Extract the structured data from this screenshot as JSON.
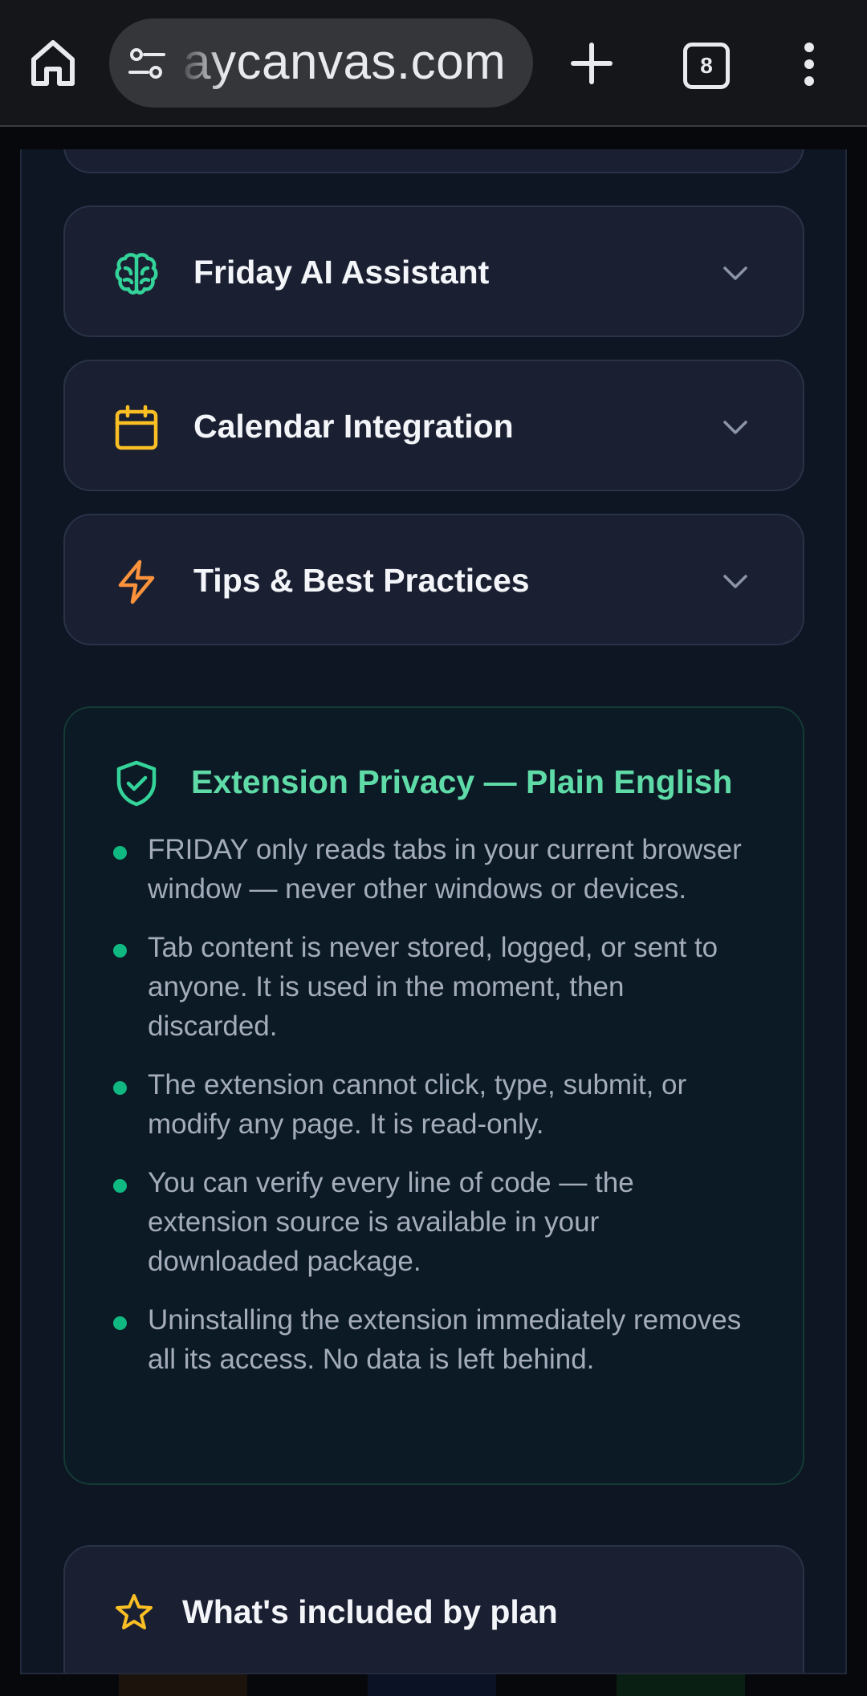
{
  "browser": {
    "url_text": "aycanvas.com",
    "tab_count": "8"
  },
  "accordion": [
    {
      "label": "Friday AI Assistant",
      "icon": "brain-icon",
      "color": "#34d399"
    },
    {
      "label": "Calendar Integration",
      "icon": "calendar-icon",
      "color": "#fbbf24"
    },
    {
      "label": "Tips & Best Practices",
      "icon": "lightning-icon",
      "color": "#fb923c"
    }
  ],
  "privacy": {
    "title": "Extension Privacy — Plain English",
    "accent_color": "#5fdba8",
    "items": [
      "FRIDAY only reads tabs in your current browser window — never other windows or devices.",
      "Tab content is never stored, logged, or sent to anyone. It is used in the moment, then discarded.",
      "The extension cannot click, type, submit, or modify any page. It is read-only.",
      "You can verify every line of code — the extension source is available in your downloaded package.",
      "Uninstalling the extension immediately removes all its access. No data is left behind."
    ]
  },
  "plans": {
    "title": "What's included by plan",
    "icon": "star-icon"
  }
}
